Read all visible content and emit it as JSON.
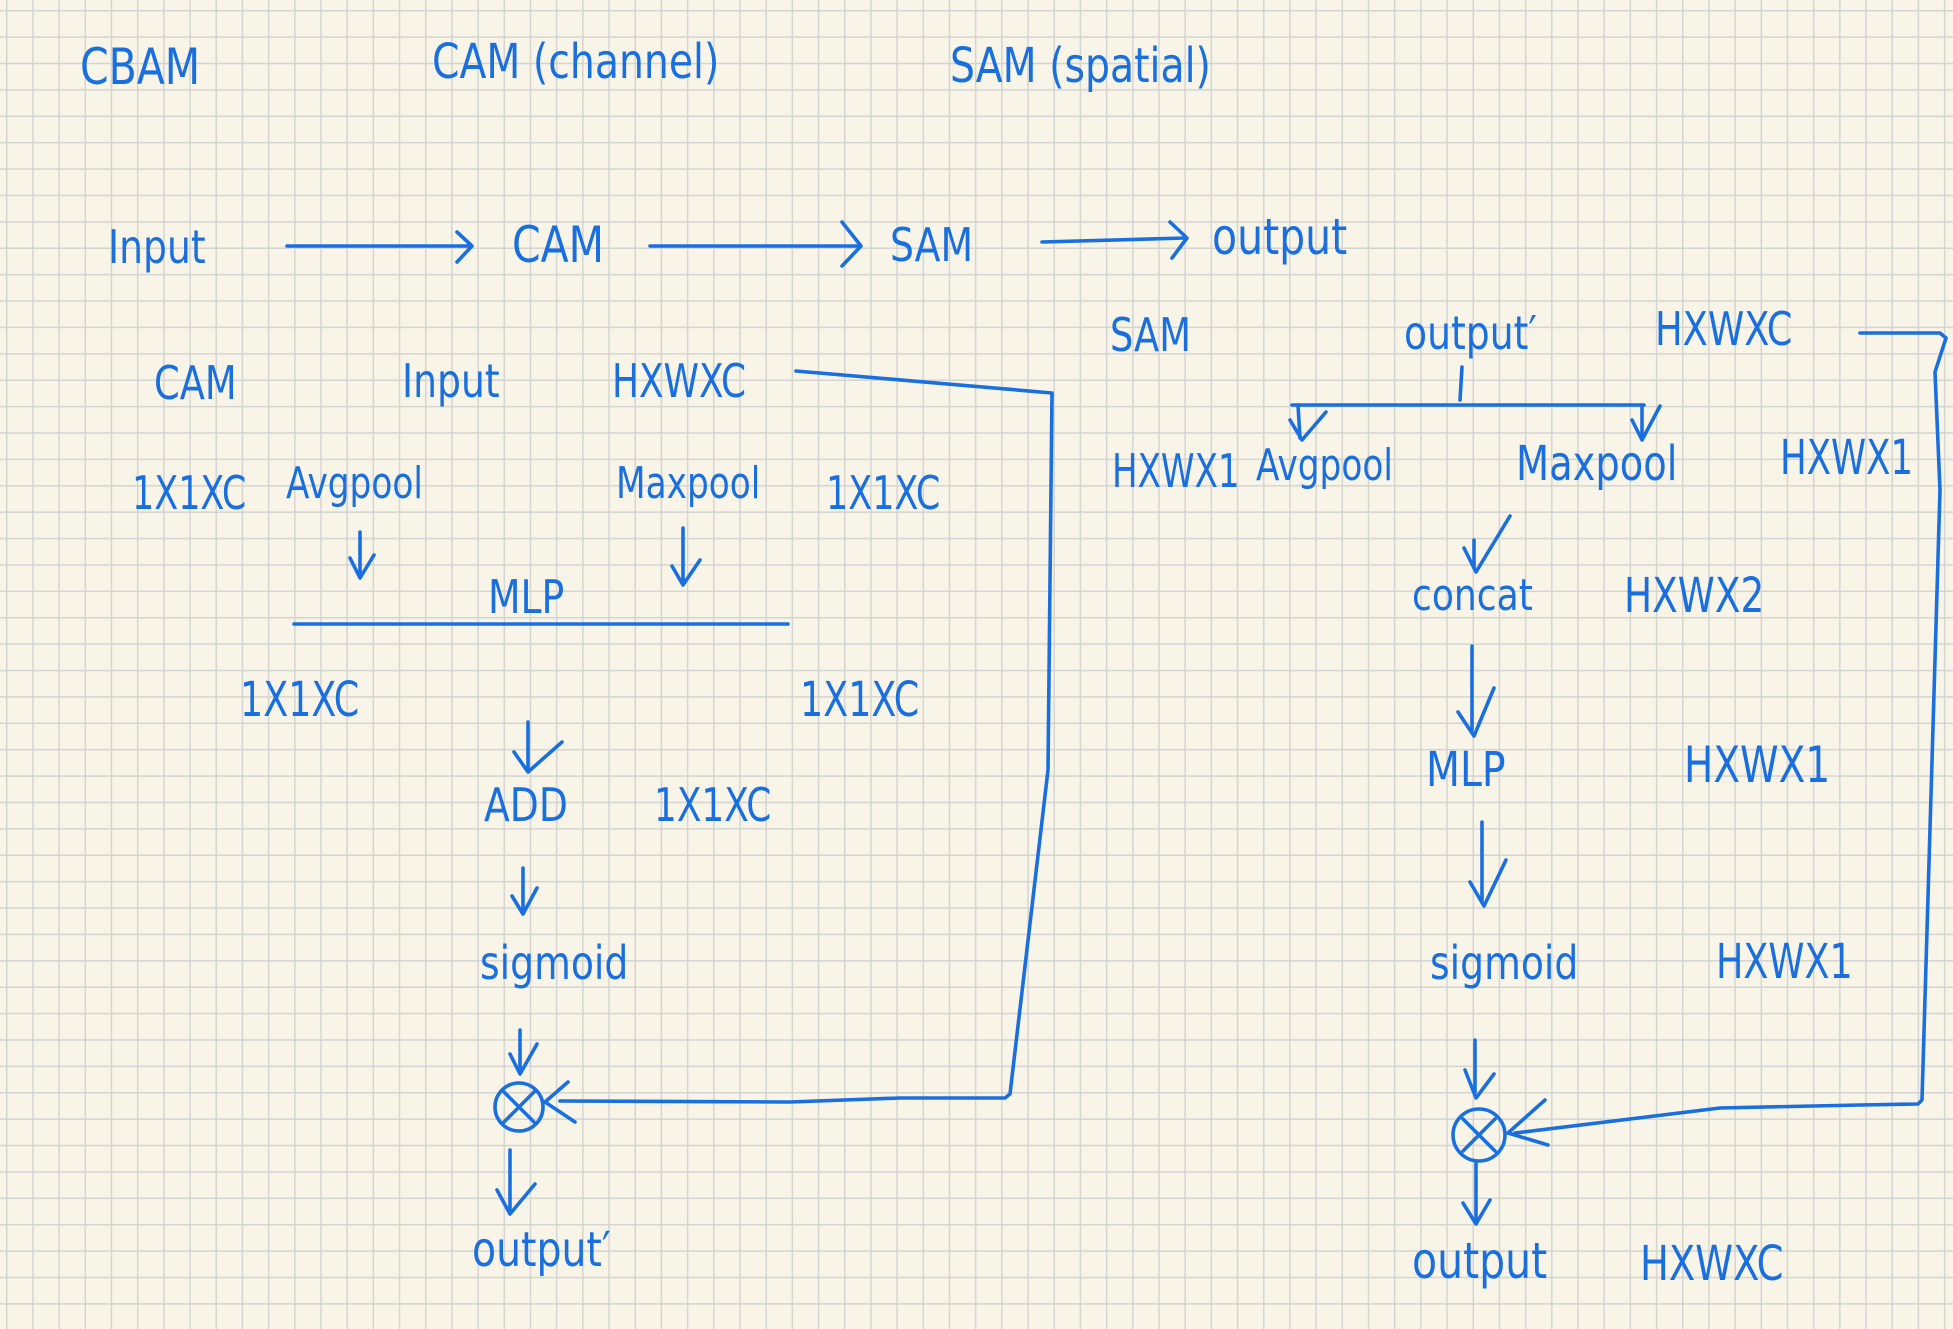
{
  "header": {
    "cbam": "CBAM",
    "cam_desc": "CAM (channel)",
    "sam_desc": "SAM (spatial)"
  },
  "pipeline": {
    "input": "Input",
    "cam": "CAM",
    "sam": "SAM",
    "output": "output"
  },
  "cam_block": {
    "title": "CAM",
    "input": "Input",
    "input_shape": "HXWXC",
    "avgpool": "Avgpool",
    "maxpool": "Maxpool",
    "avgpool_shape": "1X1XC",
    "maxpool_shape": "1X1XC",
    "mlp": "MLP",
    "mlp_out_left": "1X1XC",
    "mlp_out_right": "1X1XC",
    "add": "ADD",
    "add_shape": "1X1XC",
    "sigmoid": "sigmoid",
    "multiply": "⊗",
    "output": "output′"
  },
  "sam_block": {
    "title": "SAM",
    "input": "output′",
    "input_shape": "HXWXC",
    "avgpool": "Avgpool",
    "maxpool": "Maxpool",
    "avgpool_shape": "HXWX1",
    "maxpool_shape": "HXWX1",
    "concat": "concat",
    "concat_shape": "HXWX2",
    "mlp": "MLP",
    "mlp_shape": "HXWX1",
    "sigmoid": "sigmoid",
    "sigmoid_shape": "HXWX1",
    "multiply": "⊗",
    "output": "output",
    "output_shape": "HXWXC"
  },
  "colors": {
    "ink": "#1a6fe0",
    "paper": "#f8f5e8",
    "grid": "#d4d4d0"
  }
}
